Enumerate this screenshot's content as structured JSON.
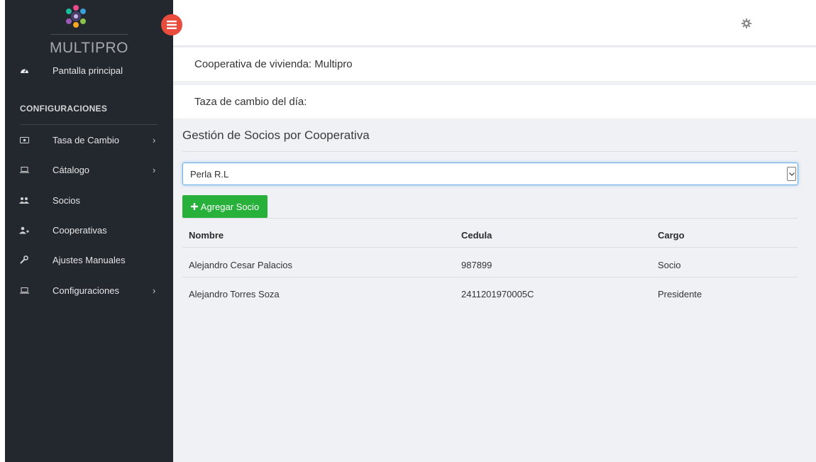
{
  "brand": {
    "name": "MULTIPRO",
    "logo_icon": "multipro-logo-icon"
  },
  "sidebar": {
    "home": {
      "label": "Pantalla principal",
      "icon": "dashboard-icon"
    },
    "section_title": "CONFIGURACIONES",
    "items": [
      {
        "label": "Tasa de Cambio",
        "icon": "money-icon",
        "has_submenu": true
      },
      {
        "label": "Cátalogo",
        "icon": "laptop-icon",
        "has_submenu": true
      },
      {
        "label": "Socios",
        "icon": "users-icon",
        "has_submenu": false
      },
      {
        "label": "Cooperativas",
        "icon": "user-plus-icon",
        "has_submenu": false
      },
      {
        "label": "Ajustes Manuales",
        "icon": "wrench-icon",
        "has_submenu": false
      },
      {
        "label": "Configuraciones",
        "icon": "laptop-icon",
        "has_submenu": true
      }
    ],
    "chevron": "›"
  },
  "topbar": {
    "settings_icon": "gear-icon",
    "toggle_icon": "menu-toggle-icon"
  },
  "info": {
    "cooperative": "Cooperativa de vivienda: Multipro",
    "exchange_rate": "Taza de cambio del día:"
  },
  "panel": {
    "title": "Gestión de Socios por Cooperativa",
    "select_value": "Perla R.L",
    "add_button": "Agregar Socio",
    "add_icon": "plus-icon"
  },
  "table": {
    "headers": [
      "Nombre",
      "Cedula",
      "Cargo"
    ],
    "rows": [
      [
        "Alejandro Cesar Palacios",
        "987899",
        "Socio"
      ],
      [
        "Alejandro Torres Soza",
        "2411201970005C",
        "Presidente"
      ]
    ]
  },
  "colors": {
    "sidebar_bg": "#23272e",
    "accent_red": "#e74c3c",
    "button_green": "#27b13b",
    "content_bg": "#f0f1f5",
    "focus_blue": "#66afe9"
  }
}
